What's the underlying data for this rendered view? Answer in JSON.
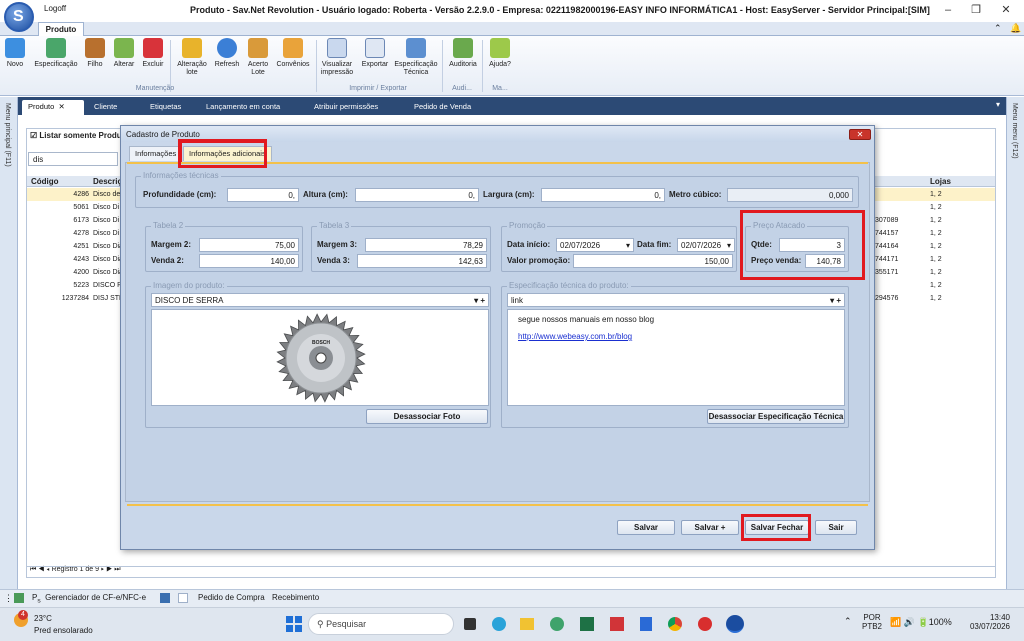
{
  "app": {
    "logoff_label": "Logoff",
    "window_title": "Produto - Sav.Net Revolution - Usuário logado: Roberta - Versão 2.2.9.0 - Empresa: 02211982000196-EASY INFO INFORMÁTICA1 - Host: EasyServer - Servidor Principal:[SIM]",
    "ribbon_tab": "Produto"
  },
  "ribbon": {
    "buttons": [
      {
        "label": "Novo",
        "icon": "new-icon"
      },
      {
        "label": "Especificação",
        "icon": "specification-icon"
      },
      {
        "label": "Filho",
        "icon": "child-icon"
      },
      {
        "label": "Alterar",
        "icon": "edit-icon"
      },
      {
        "label": "Excluir",
        "icon": "delete-icon"
      },
      {
        "label": "Alteração lote",
        "icon": "batch-edit-icon"
      },
      {
        "label": "Refresh",
        "icon": "refresh-icon"
      },
      {
        "label": "Acerto Lote",
        "icon": "batch-fix-icon"
      },
      {
        "label": "Convênios",
        "icon": "agreements-icon"
      },
      {
        "label": "Visualizar impressão",
        "icon": "print-preview-icon"
      },
      {
        "label": "Exportar",
        "icon": "export-icon"
      },
      {
        "label": "Especificação Técnica",
        "icon": "tech-spec-icon"
      },
      {
        "label": "Auditoria",
        "icon": "audit-icon"
      },
      {
        "label": "Ajuda?",
        "icon": "help-icon"
      }
    ],
    "groups": [
      "Manutenção",
      "Imprimir / Exportar",
      "Audi...",
      "Ma..."
    ]
  },
  "sidebars": {
    "left": "Menu principal (F11)",
    "right": "Menu menu (F12)"
  },
  "doc_tabs": [
    "Produto",
    "Cliente",
    "Etiquetas",
    "Lançamento em conta",
    "Atribuir permissões",
    "Pedido de Venda"
  ],
  "background": {
    "checkbox_label": "Listar somente Produ",
    "filter_value": "dis",
    "columns": [
      "Código",
      "Descriç",
      "Lojas"
    ],
    "rows": [
      {
        "code": "4286",
        "desc": "Disco de",
        "extra": "",
        "lojas": "1, 2"
      },
      {
        "code": "5061",
        "desc": "Disco Di",
        "extra": "",
        "lojas": "1, 2"
      },
      {
        "code": "6173",
        "desc": "Disco Di",
        "extra": "307089",
        "lojas": "1, 2"
      },
      {
        "code": "4278",
        "desc": "Disco Di",
        "extra": "744157",
        "lojas": "1, 2"
      },
      {
        "code": "4251",
        "desc": "Disco Dia",
        "extra": "744164",
        "lojas": "1, 2"
      },
      {
        "code": "4243",
        "desc": "Disco Dia",
        "extra": "744171",
        "lojas": "1, 2"
      },
      {
        "code": "4200",
        "desc": "Disco Dia",
        "extra": "355171",
        "lojas": "1, 2"
      },
      {
        "code": "5223",
        "desc": "DISCO P",
        "extra": "",
        "lojas": "1, 2"
      },
      {
        "code": "1237284",
        "desc": "DISJ STE",
        "extra": "294576",
        "lojas": "1, 2"
      }
    ],
    "pager": "Registro 1 de 9"
  },
  "dialog": {
    "title": "Cadastro de Produto",
    "tabs": [
      "Informações",
      "Informações adicionais"
    ],
    "tech": {
      "legend": "Informações técnicas",
      "profundidade_label": "Profundidade (cm):",
      "profundidade": "0,",
      "altura_label": "Altura (cm):",
      "altura": "0,",
      "largura_label": "Largura (cm):",
      "largura": "0,",
      "metro_label": "Metro cúbico:",
      "metro": "0,000"
    },
    "tabela2": {
      "legend": "Tabela 2",
      "margem_label": "Margem 2:",
      "margem": "75,00",
      "venda_label": "Venda 2:",
      "venda": "140,00"
    },
    "tabela3": {
      "legend": "Tabela 3",
      "margem_label": "Margem 3:",
      "margem": "78,29",
      "venda_label": "Venda 3:",
      "venda": "142,63"
    },
    "promocao": {
      "legend": "Promoção",
      "inicio_label": "Data início:",
      "inicio": "02/07/2026",
      "fim_label": "Data fim:",
      "fim": "02/07/2026",
      "valor_label": "Valor promoção:",
      "valor": "150,00"
    },
    "atacado": {
      "legend": "Preço Atacado",
      "qtde_label": "Qtde:",
      "qtde": "3",
      "venda_label": "Preço venda:",
      "venda": "140,78"
    },
    "imagem": {
      "legend": "Imagem do produto:",
      "select_value": "DISCO DE SERRA",
      "brand": "BOSCH",
      "button": "Desassociar Foto"
    },
    "especificacao": {
      "legend": "Especificação técnica do produto:",
      "select_value": "link",
      "text": "segue nossos manuais em nosso blog",
      "link": "http://www.webeasy.com.br/blog",
      "button": "Desassociar Especificação Técnica"
    },
    "buttons": {
      "salvar": "Salvar",
      "salvar_mais": "Salvar +",
      "salvar_fechar": "Salvar Fechar",
      "sair": "Sair"
    }
  },
  "statusbar": {
    "items": [
      "Gerenciador de CF-e/NFC-e",
      "Pedido de Compra",
      "Recebimento"
    ]
  },
  "taskbar": {
    "weather_temp": "23°C",
    "weather_desc": "Pred ensolarado",
    "weather_badge": "4",
    "search_placeholder": "Pesquisar",
    "lang": "POR",
    "layout": "PTB2",
    "battery": "100%",
    "time": "13:40",
    "date": "03/07/2026"
  }
}
